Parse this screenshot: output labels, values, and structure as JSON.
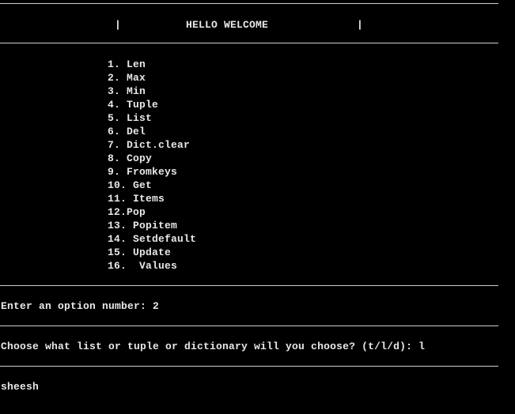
{
  "header": {
    "left_bar": "|",
    "title": "HELLO WELCOME",
    "right_bar": "|"
  },
  "menu": {
    "items": [
      "1. Len",
      "2. Max",
      "3. Min",
      "4. Tuple",
      "5. List",
      "6. Del",
      "7. Dict.clear",
      "8. Copy",
      "9. Fromkeys",
      "10. Get",
      "11. Items",
      "12.Pop",
      "13. Popitem",
      "14. Setdefault",
      "15. Update",
      "16.  Values"
    ]
  },
  "prompts": {
    "option_prompt": "Enter an option number: 2",
    "type_prompt": "Choose what list or tuple or dictionary will you choose? (t/l/d): l",
    "output": "sheesh"
  },
  "colors": {
    "background": "#000000",
    "text": "#e8e8e8",
    "rule": "#cfcfcf"
  }
}
